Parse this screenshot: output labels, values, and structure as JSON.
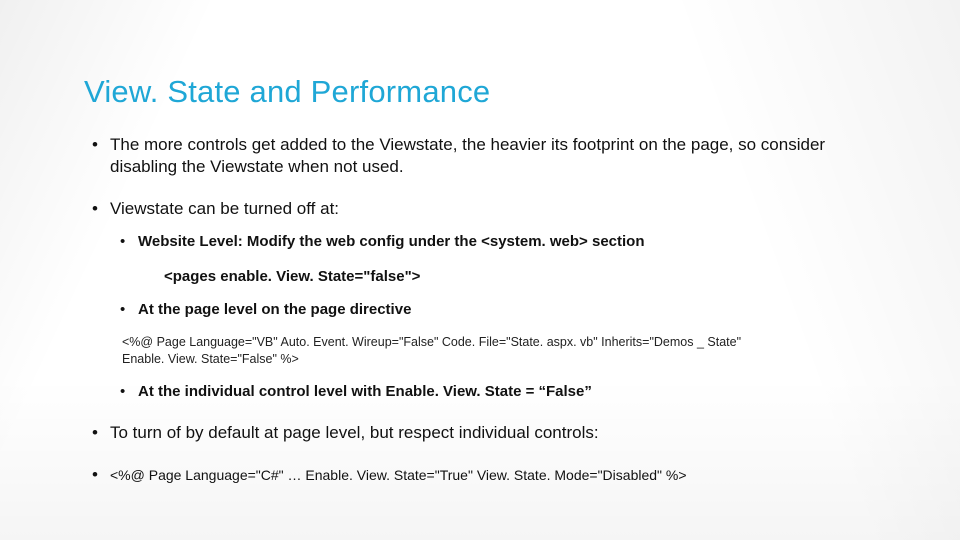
{
  "title": "View. State and Performance",
  "bullets": {
    "b1": "The more controls get added to the Viewstate, the heavier its footprint on the page, so consider disabling the Viewstate when not used.",
    "b2": "Viewstate can be turned off at:",
    "b2_sub": {
      "s1": "Website Level:  Modify the web config  under the <system. web> section",
      "s1_code": "<pages enable. View. State=\"false\">",
      "s2": "At the page level on the page directive",
      "s2_code": "<%@ Page Language=\"VB\" Auto. Event. Wireup=\"False\" Code. File=\"State. aspx. vb\" Inherits=\"Demos _ State\" Enable. View. State=\"False\" %>",
      "s3": "At the individual control level with Enable. View. State = “False”"
    },
    "b3": "To turn of by default at page level, but respect individual controls:",
    "b4": "<%@ Page Language=\"C#\" … Enable. View. State=\"True\" View. State. Mode=\"Disabled\" %>"
  }
}
